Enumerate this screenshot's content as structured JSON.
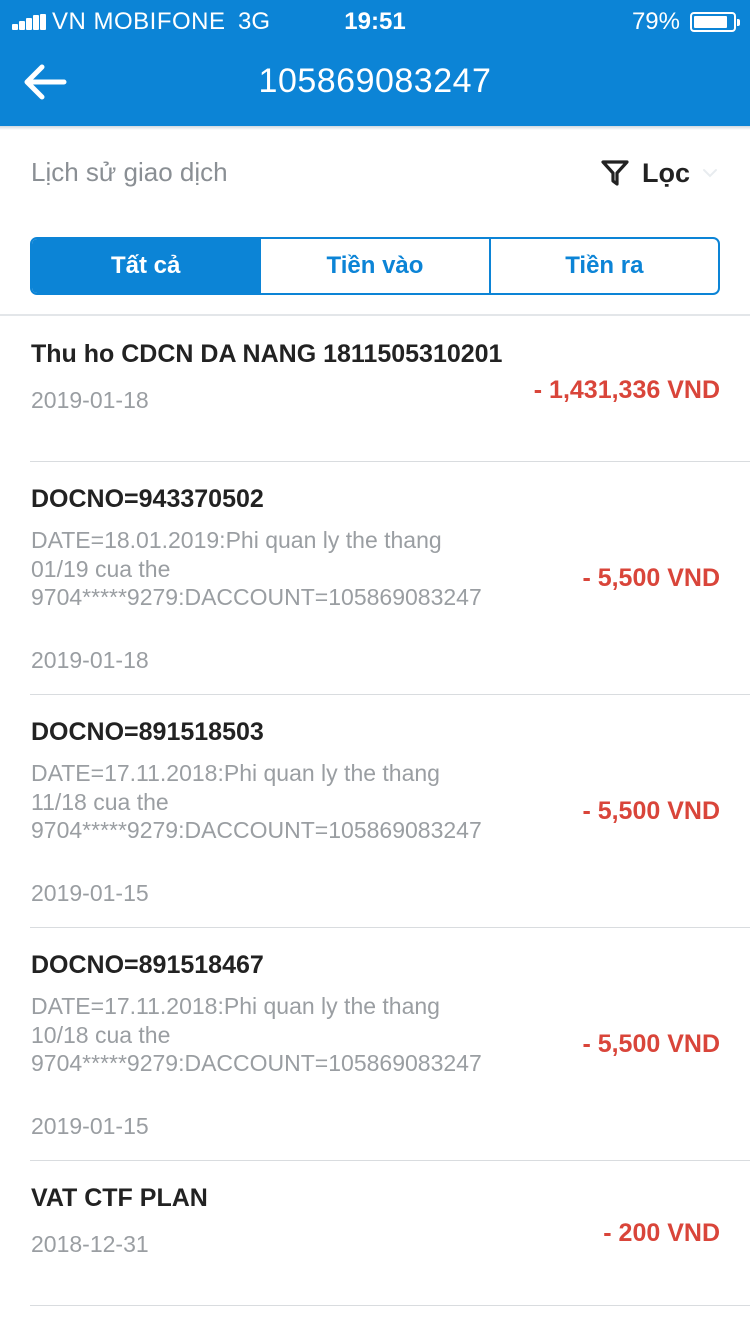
{
  "status_bar": {
    "carrier": "VN MOBIFONE",
    "network": "3G",
    "time": "19:51",
    "battery": "79%"
  },
  "nav": {
    "title": "105869083247",
    "back_icon": "arrow-left-icon"
  },
  "history": {
    "title": "Lịch sử giao dịch",
    "filter_label": "Lọc",
    "filter_icon": "funnel-icon"
  },
  "tabs": [
    {
      "label": "Tất cả",
      "active": true
    },
    {
      "label": "Tiền vào",
      "active": false
    },
    {
      "label": "Tiền ra",
      "active": false
    }
  ],
  "transactions": [
    {
      "title": "Thu ho CDCN DA NANG 1811505310201",
      "description": "",
      "date": "2019-01-18",
      "amount": "- 1,431,336 VND"
    },
    {
      "title": "DOCNO=943370502",
      "description": "DATE=18.01.2019:Phi quan ly the thang 01/19 cua the 9704*****9279:DACCOUNT=105869083247",
      "date": "2019-01-18",
      "amount": "- 5,500 VND"
    },
    {
      "title": "DOCNO=891518503",
      "description": "DATE=17.11.2018:Phi quan ly the thang 11/18 cua the 9704*****9279:DACCOUNT=105869083247",
      "date": "2019-01-15",
      "amount": "- 5,500 VND"
    },
    {
      "title": "DOCNO=891518467",
      "description": "DATE=17.11.2018:Phi quan ly the thang 10/18 cua the 9704*****9279:DACCOUNT=105869083247",
      "date": "2019-01-15",
      "amount": "- 5,500 VND"
    },
    {
      "title": "VAT CTF PLAN",
      "description": "",
      "date": "2018-12-31",
      "amount": "- 200 VND"
    }
  ],
  "colors": {
    "brand_blue": "#0c84d6",
    "debit_red": "#d9453a"
  }
}
